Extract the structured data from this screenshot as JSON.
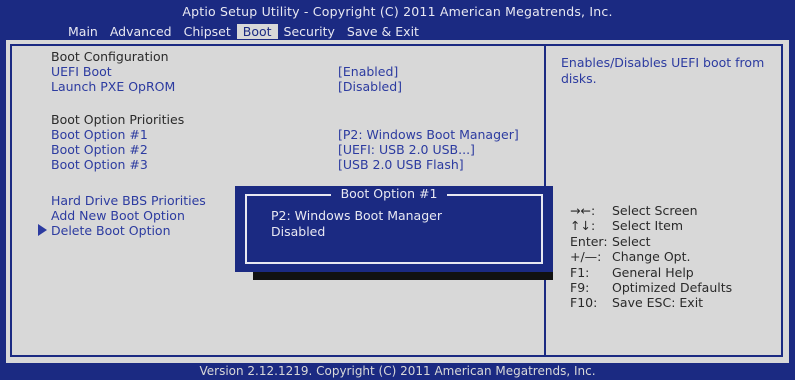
{
  "header": {
    "title": "Aptio Setup Utility - Copyright (C) 2011 American Megatrends, Inc.",
    "tabs": [
      {
        "label": "Main",
        "active": false
      },
      {
        "label": "Advanced",
        "active": false
      },
      {
        "label": "Chipset",
        "active": false
      },
      {
        "label": "Boot",
        "active": true
      },
      {
        "label": "Security",
        "active": false
      },
      {
        "label": "Save & Exit",
        "active": false
      }
    ]
  },
  "main": {
    "section1": "Boot Configuration",
    "uefi_boot": {
      "label": "UEFI Boot",
      "value": "[Enabled]"
    },
    "pxe": {
      "label": "Launch PXE OpROM",
      "value": "[Disabled]"
    },
    "section2": "Boot Option Priorities",
    "options": [
      {
        "label": "Boot Option #1",
        "value": "[P2:  Windows Boot Manager]"
      },
      {
        "label": "Boot Option #2",
        "value": "[UEFI: USB 2.0 USB...]"
      },
      {
        "label": "Boot Option #3",
        "value": "[USB 2.0 USB Flash]"
      }
    ],
    "links": {
      "hdd_bbs": "Hard Drive BBS Priorities",
      "add_boot": "Add New Boot Option",
      "delete_boot": "Delete Boot Option"
    }
  },
  "help": {
    "text": "Enables/Disables UEFI boot from disks.",
    "keys": [
      {
        "key": "→←:",
        "desc": "Select Screen"
      },
      {
        "key": "↑↓:",
        "desc": "Select Item"
      },
      {
        "key": "Enter:",
        "desc": "Select"
      },
      {
        "key": "+/—:",
        "desc": "Change Opt."
      },
      {
        "key": "F1:",
        "desc": "General Help"
      },
      {
        "key": "F9:",
        "desc": "Optimized Defaults"
      },
      {
        "key": "F10:",
        "desc": "Save   ESC:  Exit"
      }
    ]
  },
  "popup": {
    "title": "Boot Option #1",
    "options": [
      "P2:  Windows Boot Manager",
      "Disabled"
    ]
  },
  "footer": "Version 2.12.1219. Copyright (C) 2011 American Megatrends, Inc.",
  "colors": {
    "bios_blue": "#1b2a82",
    "panel_gray": "#d8d8d8",
    "link_blue": "#2c3ba0"
  }
}
